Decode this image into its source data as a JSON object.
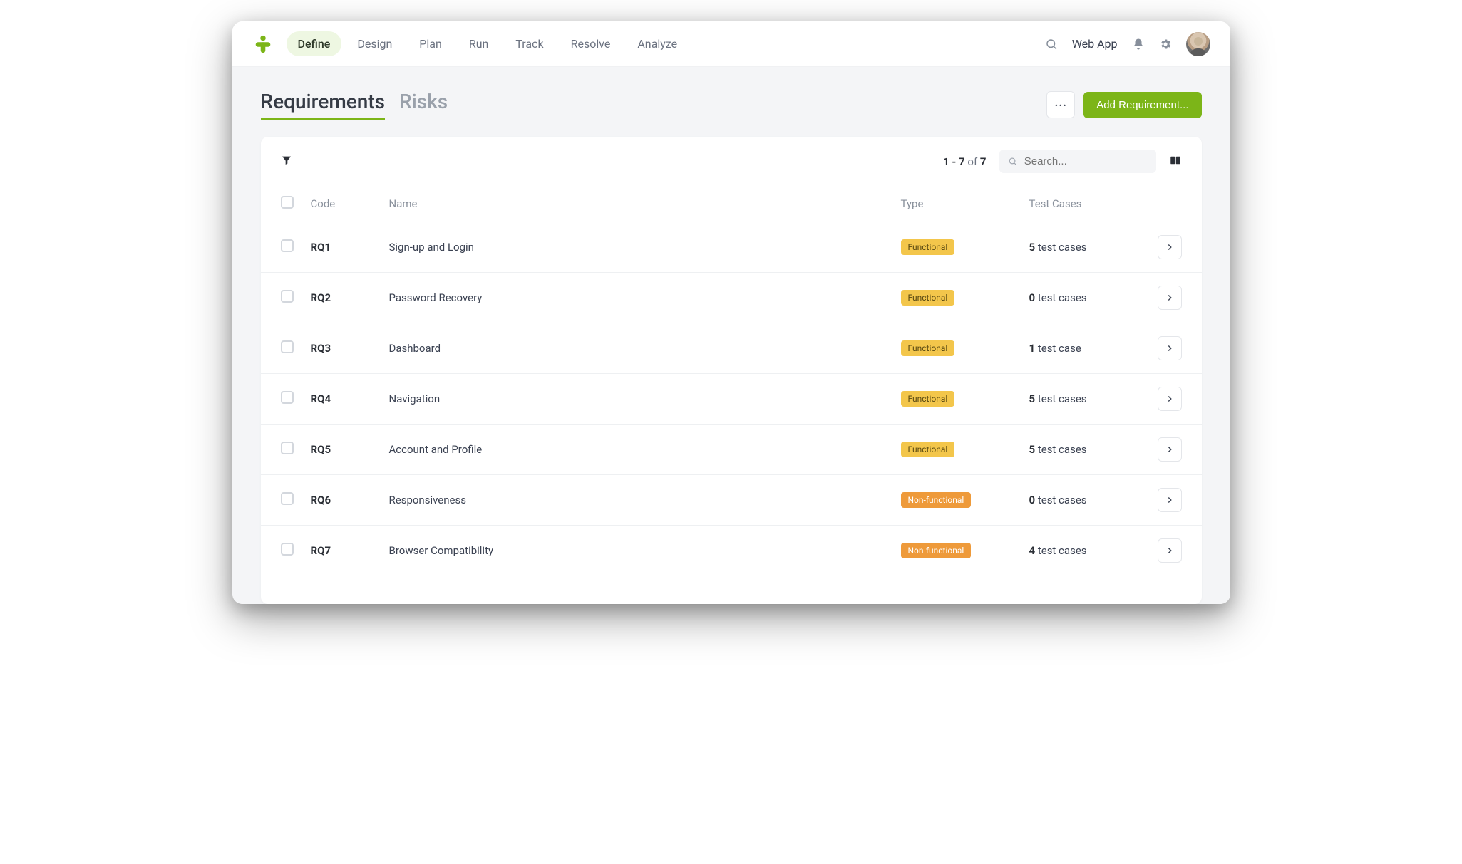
{
  "nav": {
    "items": [
      "Define",
      "Design",
      "Plan",
      "Run",
      "Track",
      "Resolve",
      "Analyze"
    ],
    "active_index": 0
  },
  "topbar": {
    "project_label": "Web App"
  },
  "page": {
    "tabs": [
      "Requirements",
      "Risks"
    ],
    "active_tab_index": 0,
    "more_label": "···",
    "add_button_label": "Add Requirement..."
  },
  "toolbar": {
    "pager_prefix": "1 - 7",
    "pager_of": " of ",
    "pager_total": "7",
    "search_placeholder": "Search..."
  },
  "table": {
    "columns": [
      "",
      "Code",
      "Name",
      "Type",
      "Test Cases",
      ""
    ],
    "rows": [
      {
        "code": "RQ1",
        "name": "Sign-up and Login",
        "type": "Functional",
        "type_class": "func",
        "tc_count": "5",
        "tc_label": " test cases"
      },
      {
        "code": "RQ2",
        "name": "Password Recovery",
        "type": "Functional",
        "type_class": "func",
        "tc_count": "0",
        "tc_label": " test cases"
      },
      {
        "code": "RQ3",
        "name": "Dashboard",
        "type": "Functional",
        "type_class": "func",
        "tc_count": "1",
        "tc_label": " test case"
      },
      {
        "code": "RQ4",
        "name": "Navigation",
        "type": "Functional",
        "type_class": "func",
        "tc_count": "5",
        "tc_label": " test cases"
      },
      {
        "code": "RQ5",
        "name": "Account and Profile",
        "type": "Functional",
        "type_class": "func",
        "tc_count": "5",
        "tc_label": " test cases"
      },
      {
        "code": "RQ6",
        "name": "Responsiveness",
        "type": "Non-functional",
        "type_class": "nonfunc",
        "tc_count": "0",
        "tc_label": " test cases"
      },
      {
        "code": "RQ7",
        "name": "Browser Compatibility",
        "type": "Non-functional",
        "type_class": "nonfunc",
        "tc_count": "4",
        "tc_label": " test cases"
      }
    ]
  },
  "colors": {
    "accent": "#7cb518",
    "badge_functional": "#f3c64b",
    "badge_nonfunctional": "#ee9a3a"
  }
}
